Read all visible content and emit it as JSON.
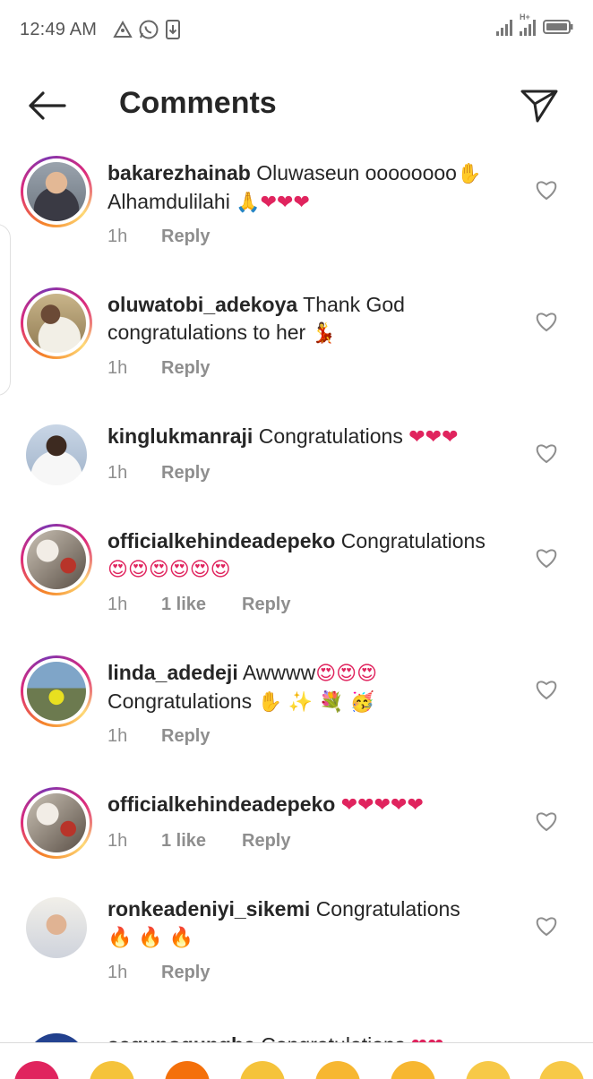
{
  "status": {
    "time": "12:49 AM",
    "network_label": "H+"
  },
  "header": {
    "title": "Comments"
  },
  "comments": [
    {
      "username": "bakarezhainab",
      "text": "Oluwaseun oooooooo",
      "line2": "Alhamdulilahi",
      "time": "1h",
      "reply": "Reply"
    },
    {
      "username": "oluwatobi_adekoya",
      "text": "Thank God",
      "line2": "congratulations to her",
      "time": "1h",
      "reply": "Reply"
    },
    {
      "username": "kinglukmanraji",
      "text": "Congratulations",
      "time": "1h",
      "reply": "Reply"
    },
    {
      "username": "officialkehindeadepeko",
      "text": "Congratulations",
      "time": "1h",
      "likes": "1 like",
      "reply": "Reply"
    },
    {
      "username": "linda_adedeji",
      "text": "Awwww",
      "line2": "Congratulations",
      "time": "1h",
      "reply": "Reply"
    },
    {
      "username": "officialkehindeadepeko",
      "text": "",
      "time": "1h",
      "likes": "1 like",
      "reply": "Reply"
    },
    {
      "username": "ronkeadeniyi_sikemi",
      "text": "Congratulations",
      "time": "1h",
      "reply": "Reply"
    },
    {
      "username": "segunogungbe",
      "text": "Congratulations"
    }
  ],
  "colors": {
    "text": "#262626",
    "meta": "#8e8e8e",
    "heart_red": "#e0245e"
  },
  "icons": [
    "back-arrow-icon",
    "send-icon",
    "heart-outline-icon",
    "whatsapp-icon",
    "download-icon",
    "triangle-icon",
    "signal-icon",
    "battery-icon"
  ]
}
